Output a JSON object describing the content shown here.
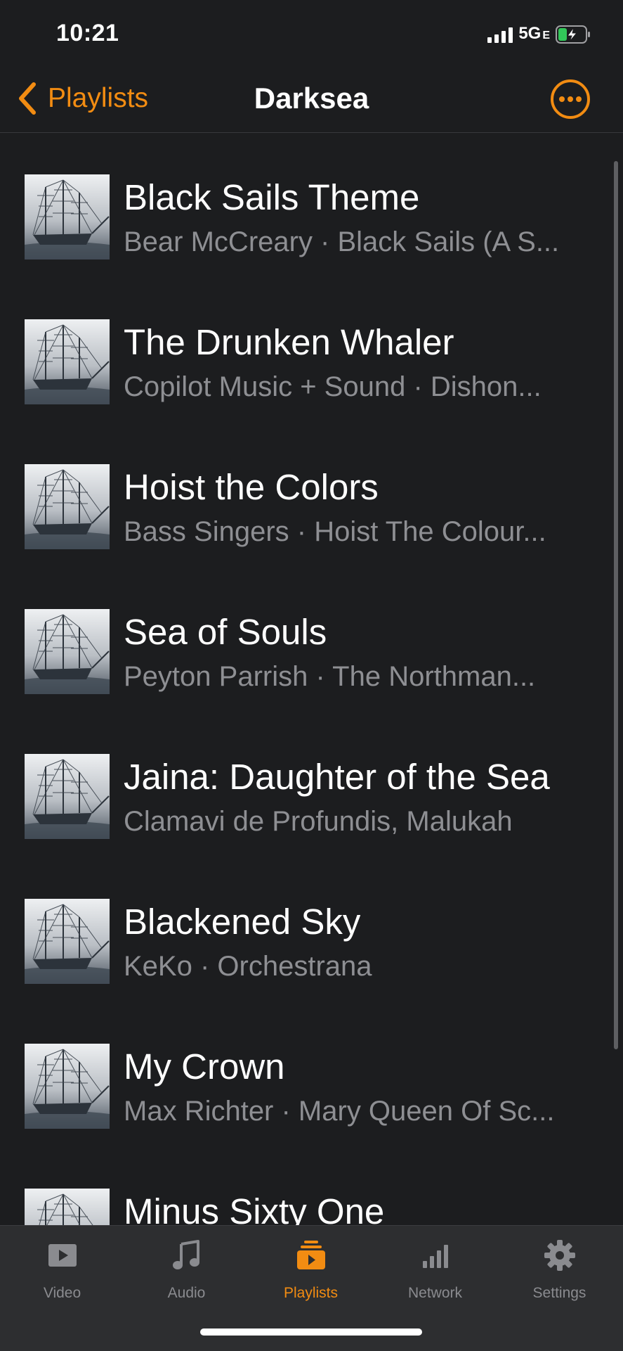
{
  "status_bar": {
    "time": "10:21",
    "network": "5G",
    "network_suffix": "E"
  },
  "header": {
    "back_label": "Playlists",
    "title": "Darksea"
  },
  "tracks": [
    {
      "title": "Black Sails Theme",
      "subtitle": "Bear McCreary · Black Sails (A S..."
    },
    {
      "title": "The Drunken Whaler",
      "subtitle": "Copilot Music + Sound · Dishon..."
    },
    {
      "title": "Hoist the Colors",
      "subtitle": "Bass Singers · Hoist The Colour..."
    },
    {
      "title": "Sea of Souls",
      "subtitle": "Peyton Parrish · The Northman..."
    },
    {
      "title": "Jaina: Daughter of the Sea",
      "subtitle": "Clamavi de Profundis, Malukah"
    },
    {
      "title": "Blackened Sky",
      "subtitle": "KeKo · Orchestrana"
    },
    {
      "title": "My Crown",
      "subtitle": "Max Richter · Mary Queen Of Sc..."
    },
    {
      "title": "Minus Sixty One",
      "subtitle": ""
    }
  ],
  "tabs": [
    {
      "label": "Video",
      "icon": "video-icon",
      "active": false
    },
    {
      "label": "Audio",
      "icon": "music-note-icon",
      "active": false
    },
    {
      "label": "Playlists",
      "icon": "playlist-icon",
      "active": true
    },
    {
      "label": "Network",
      "icon": "network-icon",
      "active": false
    },
    {
      "label": "Settings",
      "icon": "gear-icon",
      "active": false
    }
  ],
  "colors": {
    "accent": "#f28c12",
    "background": "#1c1d1f",
    "tab_bar": "#2d2e30",
    "subtitle": "#8e8f93",
    "battery_fill": "#32c759"
  }
}
